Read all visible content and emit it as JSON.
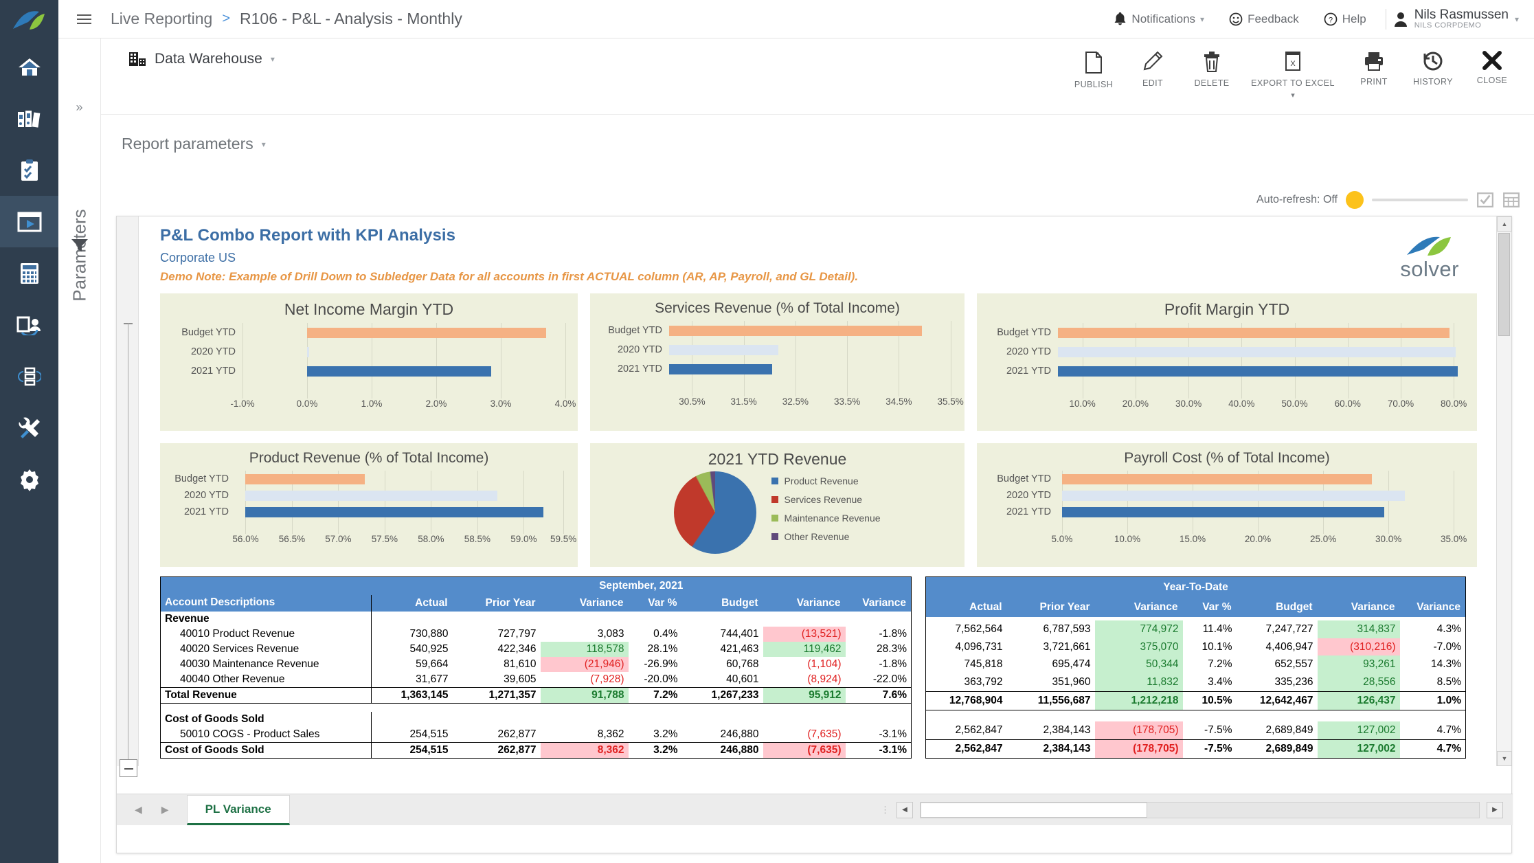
{
  "brand": {
    "accent": "#4a90d9",
    "rail_bg": "#2f3e4e",
    "header_blue": "#548ccb",
    "pos_green": "#1a7a2e",
    "neg_red": "#e02020",
    "hl_green": "#c6efce",
    "hl_red": "#ffc7ce",
    "bar_budget": "#f5b183",
    "bar_2020": "#dbe5f1",
    "bar_2021": "#3a72ae",
    "toggle_yellow": "#fcc21b",
    "tab_green": "#1e7145"
  },
  "header": {
    "breadcrumb_root": "Live Reporting",
    "breadcrumb_sep": ">",
    "breadcrumb_current": "R106 - P&L - Analysis - Monthly",
    "notifications": "Notifications",
    "feedback": "Feedback",
    "help": "Help",
    "user_name": "Nils Rasmussen",
    "user_org": "Nils CorpDemo"
  },
  "sidebar": {
    "items": [
      {
        "name": "home",
        "label": "Home"
      },
      {
        "name": "reports",
        "label": "Reports"
      },
      {
        "name": "tasks",
        "label": "Tasks"
      },
      {
        "name": "live-reporting",
        "label": "Live Reporting",
        "active": true
      },
      {
        "name": "budgeting",
        "label": "Budgeting"
      },
      {
        "name": "data-entry",
        "label": "Data Entry"
      },
      {
        "name": "workflow",
        "label": "Workflow"
      },
      {
        "name": "tools",
        "label": "Tools"
      },
      {
        "name": "settings",
        "label": "Settings"
      }
    ]
  },
  "parameters_panel": {
    "label": "Parameters"
  },
  "toolbar": {
    "datasource": "Data Warehouse",
    "report_parameters": "Report parameters",
    "actions": [
      {
        "name": "publish",
        "label": "PUBLISH"
      },
      {
        "name": "edit",
        "label": "EDIT"
      },
      {
        "name": "delete",
        "label": "DELETE"
      },
      {
        "name": "export-to-excel",
        "label": "EXPORT TO EXCEL",
        "has_caret": true
      },
      {
        "name": "print",
        "label": "PRINT"
      },
      {
        "name": "history",
        "label": "HISTORY"
      },
      {
        "name": "close",
        "label": "CLOSE"
      }
    ],
    "auto_refresh": "Auto-refresh: Off"
  },
  "report": {
    "title": "P&L Combo Report with KPI Analysis",
    "subtitle": "Corporate US",
    "note": "Demo Note: Example of Drill Down to Subledger Data for all accounts in first ACTUAL column (AR, AP, Payroll, and GL Detail).",
    "logo_text": "solver"
  },
  "chart_data": [
    {
      "type": "bar",
      "orientation": "horizontal",
      "title": "Net Income Margin YTD",
      "categories": [
        "Budget YTD",
        "2020 YTD",
        "2021 YTD"
      ],
      "values": [
        3.7,
        0.0,
        2.85
      ],
      "series_colors": [
        "#f5b183",
        "#dbe5f1",
        "#3a72ae"
      ],
      "ticks": [
        "-1.0%",
        "0.0%",
        "1.0%",
        "2.0%",
        "3.0%",
        "4.0%"
      ],
      "tickvals": [
        -1.0,
        0.0,
        1.0,
        2.0,
        3.0,
        4.0
      ],
      "xlim": [
        -1.0,
        4.0
      ],
      "ylabel": "",
      "xlabel": "",
      "grid": true,
      "legend": "none"
    },
    {
      "type": "bar",
      "orientation": "horizontal",
      "title": "Services Revenue (% of Total Income)",
      "categories": [
        "Budget YTD",
        "2020 YTD",
        "2021 YTD"
      ],
      "values": [
        34.85,
        32.15,
        32.05
      ],
      "series_colors": [
        "#f5b183",
        "#dbe5f1",
        "#3a72ae"
      ],
      "ticks": [
        "30.5%",
        "31.5%",
        "32.5%",
        "33.5%",
        "34.5%",
        "35.5%"
      ],
      "tickvals": [
        30.5,
        31.5,
        32.5,
        33.5,
        34.5,
        35.5
      ],
      "xlim": [
        30.0,
        36.0
      ],
      "grid": true,
      "legend": "none"
    },
    {
      "type": "bar",
      "orientation": "horizontal",
      "title": "Profit Margin YTD",
      "categories": [
        "Budget YTD",
        "2020 YTD",
        "2021 YTD"
      ],
      "values": [
        79.3,
        79.7,
        79.9
      ],
      "series_colors": [
        "#f5b183",
        "#dbe5f1",
        "#3a72ae"
      ],
      "ticks": [
        "10.0%",
        "20.0%",
        "30.0%",
        "40.0%",
        "50.0%",
        "60.0%",
        "70.0%",
        "80.0%"
      ],
      "tickvals": [
        10,
        20,
        30,
        40,
        50,
        60,
        70,
        80
      ],
      "xlim": [
        5,
        82
      ],
      "grid": true,
      "legend": "none"
    },
    {
      "type": "bar",
      "orientation": "horizontal",
      "title": "Product Revenue (% of Total Income)",
      "categories": [
        "Budget YTD",
        "2020 YTD",
        "2021 YTD"
      ],
      "values": [
        57.35,
        58.75,
        59.25
      ],
      "series_colors": [
        "#f5b183",
        "#dbe5f1",
        "#3a72ae"
      ],
      "ticks": [
        "56.0%",
        "56.5%",
        "57.0%",
        "57.5%",
        "58.0%",
        "58.5%",
        "59.0%",
        "59.5%"
      ],
      "tickvals": [
        56.0,
        56.5,
        57.0,
        57.5,
        58.0,
        58.5,
        59.0,
        59.5
      ],
      "xlim": [
        56.0,
        59.7
      ],
      "grid": true,
      "legend": "none"
    },
    {
      "type": "pie",
      "title": "2021 YTD Revenue",
      "labels": [
        "Product Revenue",
        "Services Revenue",
        "Maintenance Revenue",
        "Other Revenue"
      ],
      "values": [
        59.2,
        32.1,
        5.8,
        2.8
      ],
      "colors": [
        "#3a72ae",
        "#c0392b",
        "#9bbb59",
        "#604a7b"
      ],
      "legend": "right"
    },
    {
      "type": "bar",
      "orientation": "horizontal",
      "title": "Payroll Cost (% of Total Income)",
      "categories": [
        "Budget YTD",
        "2020 YTD",
        "2021 YTD"
      ],
      "values": [
        28.9,
        31.4,
        30.0
      ],
      "series_colors": [
        "#f5b183",
        "#dbe5f1",
        "#3a72ae"
      ],
      "ticks": [
        "5.0%",
        "10.0%",
        "15.0%",
        "20.0%",
        "25.0%",
        "30.0%",
        "35.0%"
      ],
      "tickvals": [
        5,
        10,
        15,
        20,
        25,
        30,
        35
      ],
      "xlim": [
        5,
        36
      ],
      "grid": true,
      "legend": "none"
    }
  ],
  "table": {
    "desc_header": "Account Descriptions",
    "period_left": "September, 2021",
    "period_right": "Year-To-Date",
    "columns": [
      "Actual",
      "Prior Year",
      "Variance",
      "Var %",
      "Budget",
      "Variance",
      "Variance"
    ],
    "rows": [
      {
        "kind": "section",
        "label": "Revenue",
        "left": [
          "",
          "",
          "",
          "",
          "",
          "",
          ""
        ],
        "right": [
          "",
          "",
          "",
          "",
          "",
          "",
          ""
        ]
      },
      {
        "kind": "detail",
        "label": "40010 Product Revenue",
        "left": [
          "730,880",
          "727,797",
          "3,083",
          "0.4%",
          "744,401",
          "(13,521)",
          "-1.8%"
        ],
        "left_style": [
          "",
          "",
          "",
          "",
          "",
          "hl-red",
          ""
        ],
        "right": [
          "7,562,564",
          "6,787,593",
          "774,972",
          "11.4%",
          "7,247,727",
          "314,837",
          "4.3%"
        ],
        "right_style": [
          "",
          "",
          "hl-green",
          "",
          "",
          "hl-green",
          ""
        ]
      },
      {
        "kind": "detail",
        "label": "40020 Services Revenue",
        "left": [
          "540,925",
          "422,346",
          "118,578",
          "28.1%",
          "421,463",
          "119,462",
          "28.3%"
        ],
        "left_style": [
          "",
          "",
          "hl-green",
          "",
          "",
          "hl-green",
          ""
        ],
        "right": [
          "4,096,731",
          "3,721,661",
          "375,070",
          "10.1%",
          "4,406,947",
          "(310,216)",
          "-7.0%"
        ],
        "right_style": [
          "",
          "",
          "hl-green",
          "",
          "",
          "hl-red",
          ""
        ]
      },
      {
        "kind": "detail",
        "label": "40030 Maintenance Revenue",
        "left": [
          "59,664",
          "81,610",
          "(21,946)",
          "-26.9%",
          "60,768",
          "(1,104)",
          "-1.8%"
        ],
        "left_style": [
          "",
          "",
          "hl-red",
          "",
          "",
          "neg",
          ""
        ],
        "right": [
          "745,818",
          "695,474",
          "50,344",
          "7.2%",
          "652,557",
          "93,261",
          "14.3%"
        ],
        "right_style": [
          "",
          "",
          "hl-green",
          "",
          "",
          "hl-green",
          ""
        ]
      },
      {
        "kind": "detail",
        "label": "40040 Other Revenue",
        "left": [
          "31,677",
          "39,605",
          "(7,928)",
          "-20.0%",
          "40,601",
          "(8,924)",
          "-22.0%"
        ],
        "left_style": [
          "",
          "",
          "neg",
          "",
          "",
          "neg",
          ""
        ],
        "right": [
          "363,792",
          "351,960",
          "11,832",
          "3.4%",
          "335,236",
          "28,556",
          "8.5%"
        ],
        "right_style": [
          "",
          "",
          "hl-green",
          "",
          "",
          "hl-green",
          ""
        ]
      },
      {
        "kind": "total",
        "label": "Total Revenue",
        "left": [
          "1,363,145",
          "1,271,357",
          "91,788",
          "7.2%",
          "1,267,233",
          "95,912",
          "7.6%"
        ],
        "left_style": [
          "",
          "",
          "hl-green",
          "",
          "",
          "hl-green",
          ""
        ],
        "right": [
          "12,768,904",
          "11,556,687",
          "1,212,218",
          "10.5%",
          "12,642,467",
          "126,437",
          "1.0%"
        ],
        "right_style": [
          "",
          "",
          "hl-green",
          "",
          "",
          "hl-green",
          ""
        ]
      },
      {
        "kind": "spacer"
      },
      {
        "kind": "section",
        "label": "Cost of Goods Sold",
        "left": [
          "",
          "",
          "",
          "",
          "",
          "",
          ""
        ],
        "right": [
          "",
          "",
          "",
          "",
          "",
          "",
          ""
        ]
      },
      {
        "kind": "detail",
        "label": "50010 COGS - Product Sales",
        "left": [
          "254,515",
          "262,877",
          "8,362",
          "3.2%",
          "246,880",
          "(7,635)",
          "-3.1%"
        ],
        "left_style": [
          "",
          "",
          "",
          "",
          "",
          "neg",
          ""
        ],
        "right": [
          "2,562,847",
          "2,384,143",
          "(178,705)",
          "-7.5%",
          "2,689,849",
          "127,002",
          "4.7%"
        ],
        "right_style": [
          "",
          "",
          "hl-red",
          "",
          "",
          "hl-green",
          ""
        ]
      },
      {
        "kind": "total",
        "label": "Cost of Goods Sold",
        "left": [
          "254,515",
          "262,877",
          "8,362",
          "3.2%",
          "246,880",
          "(7,635)",
          "-3.1%"
        ],
        "left_style": [
          "",
          "",
          "hl-red",
          "",
          "",
          "hl-red",
          ""
        ],
        "right": [
          "2,562,847",
          "2,384,143",
          "(178,705)",
          "-7.5%",
          "2,689,849",
          "127,002",
          "4.7%"
        ],
        "right_style": [
          "",
          "",
          "hl-red",
          "",
          "",
          "hl-green",
          ""
        ]
      }
    ]
  },
  "sheet_tabs": {
    "active": "PL Variance"
  }
}
